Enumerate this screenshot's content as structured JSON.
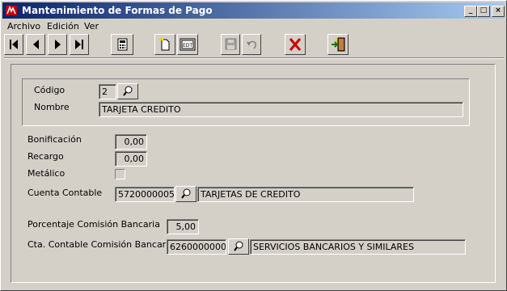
{
  "window": {
    "title": "Mantenimiento de Formas de Pago",
    "controls": {
      "minimize": "_",
      "maximize": "□",
      "close": "×"
    }
  },
  "menu": {
    "items": [
      "Archivo",
      "Edición",
      "Ver"
    ]
  },
  "toolbar": {
    "icons": [
      "first-record-icon",
      "previous-record-icon",
      "next-record-icon",
      "last-record-icon",
      "calculator-icon",
      "new-record-icon",
      "edit-record-icon",
      "save-icon",
      "undo-icon",
      "delete-icon",
      "exit-icon"
    ],
    "accent_colors": {
      "delete": "#cc0000",
      "new": "#ffcc00"
    }
  },
  "form": {
    "codigo": {
      "label": "Código",
      "value": "2"
    },
    "nombre": {
      "label": "Nombre",
      "value": "TARJETA CREDITO"
    },
    "bonificacion": {
      "label": "Bonificación",
      "value": "0,00"
    },
    "recargo": {
      "label": "Recargo",
      "value": "0,00"
    },
    "metalico": {
      "label": "Metálico",
      "checked": false
    },
    "cuenta_contable": {
      "label": "Cuenta Contable",
      "code": "5720000005",
      "description": "TARJETAS DE CREDITO"
    },
    "porcentaje_comision": {
      "label": "Porcentaje Comisión Bancaria",
      "value": "5,00"
    },
    "cta_comision": {
      "label": "Cta. Contable Comisión Bancaria",
      "code": "6260000000",
      "description": "SERVICIOS BANCARIOS Y SIMILARES"
    }
  }
}
